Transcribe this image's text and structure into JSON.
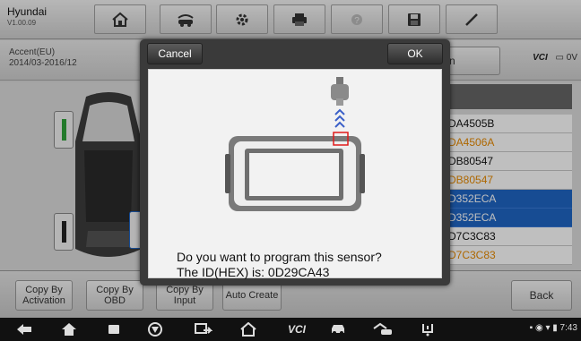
{
  "app": {
    "name": "Hyundai",
    "version": "V1.00.09"
  },
  "toolbar": {
    "icons": [
      "home-icon",
      "vehicle-swap-icon",
      "gear-icon",
      "printer-icon",
      "help-icon",
      "save-icon",
      "pen-icon"
    ]
  },
  "vehicle": {
    "model": "Accent(EU)",
    "years": "2014/03-2016/12"
  },
  "vci": {
    "label": "VCI",
    "battery": "0V"
  },
  "header_button_fragment": "n",
  "sensor_ids": [
    {
      "text": "DA4505B",
      "color": "black",
      "selected": false
    },
    {
      "text": "DA4506A",
      "color": "orange",
      "selected": false
    },
    {
      "text": "DB80547",
      "color": "black",
      "selected": false
    },
    {
      "text": "DB80547",
      "color": "orange",
      "selected": false
    },
    {
      "text": "D352ECA",
      "color": "white",
      "selected": true
    },
    {
      "text": "D352ECA",
      "color": "white",
      "selected": true
    },
    {
      "text": "D7C3C83",
      "color": "black",
      "selected": false
    },
    {
      "text": "D7C3C83",
      "color": "orange",
      "selected": false
    }
  ],
  "actions": {
    "copy_activation": "Copy By Activation",
    "copy_obd": "Copy By OBD",
    "copy_input": "Copy By Input",
    "auto_create": "Auto Create",
    "back": "Back"
  },
  "dialog": {
    "cancel": "Cancel",
    "ok": "OK",
    "question": "Do you want to program this sensor?",
    "id_line": "The ID(HEX) is: 0D29CA43"
  },
  "colors": {
    "selected_row": "#1f66c5",
    "orange_text": "#e88a00",
    "sensor_green": "#2fa33a"
  },
  "statusbar": {
    "time": "7:43"
  },
  "navbar": {
    "icons": [
      "back-icon",
      "home-icon",
      "recents-icon",
      "browser-icon",
      "screen-mirror-icon",
      "autel-home-icon",
      "vci-icon",
      "car-icon",
      "garage-icon",
      "tpms-icon"
    ]
  }
}
